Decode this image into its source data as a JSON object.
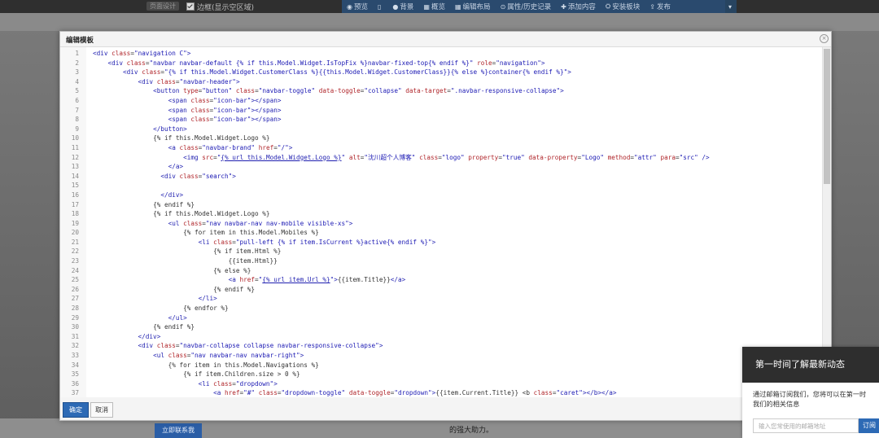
{
  "topbar": {
    "mode_label": "页面设计",
    "border_toggle_label": "边框(显示空区域)",
    "tools": [
      {
        "icon": "eye-icon",
        "glyph": "◉",
        "label": "预览"
      },
      {
        "icon": "mobile-icon",
        "glyph": "▯",
        "label": ""
      },
      {
        "icon": "droplet-icon",
        "glyph": "●",
        "label": "背景"
      },
      {
        "icon": "grid-icon",
        "glyph": "▦",
        "label": "概览"
      },
      {
        "icon": "layout-icon",
        "glyph": "▦",
        "label": "编辑布局"
      },
      {
        "icon": "history-icon",
        "glyph": "⊙",
        "label": "属性/历史记录"
      },
      {
        "icon": "plus-icon",
        "glyph": "✚",
        "label": "添加内容"
      },
      {
        "icon": "install-icon",
        "glyph": "⛭",
        "label": "安装板块"
      },
      {
        "icon": "publish-icon",
        "glyph": "⇪",
        "label": "发布"
      }
    ]
  },
  "dialog": {
    "title": "编辑模板",
    "ok_label": "确定",
    "cancel_label": "取消"
  },
  "code_lines": [
    {
      "n": "1",
      "indent": 0,
      "tokens": [
        [
          "tag",
          "<div "
        ],
        [
          "attr",
          "class"
        ],
        [
          "text",
          "="
        ],
        [
          "str",
          "\"navigation C\""
        ],
        [
          "tag",
          ">"
        ]
      ]
    },
    {
      "n": "2",
      "indent": 2,
      "tokens": [
        [
          "tag",
          "<div "
        ],
        [
          "attr",
          "class"
        ],
        [
          "text",
          "="
        ],
        [
          "str",
          "\"navbar navbar-default {% if this.Model.Widget.IsTopFix %}navbar-fixed-top{% endif %}\""
        ],
        [
          "text",
          " "
        ],
        [
          "attr",
          "role"
        ],
        [
          "text",
          "="
        ],
        [
          "str",
          "\"navigation\""
        ],
        [
          "tag",
          ">"
        ]
      ]
    },
    {
      "n": "3",
      "indent": 4,
      "tokens": [
        [
          "tag",
          "<div "
        ],
        [
          "attr",
          "class"
        ],
        [
          "text",
          "="
        ],
        [
          "str",
          "\"{% if this.Model.Widget.CustomerClass %}{{this.Model.Widget.CustomerClass}}{% else %}container{% endif %}\""
        ],
        [
          "tag",
          ">"
        ]
      ]
    },
    {
      "n": "4",
      "indent": 6,
      "tokens": [
        [
          "tag",
          "<div "
        ],
        [
          "attr",
          "class"
        ],
        [
          "text",
          "="
        ],
        [
          "str",
          "\"navbar-header\""
        ],
        [
          "tag",
          ">"
        ]
      ]
    },
    {
      "n": "5",
      "indent": 8,
      "tokens": [
        [
          "tag",
          "<button "
        ],
        [
          "attr",
          "type"
        ],
        [
          "text",
          "="
        ],
        [
          "str",
          "\"button\""
        ],
        [
          "text",
          " "
        ],
        [
          "attr",
          "class"
        ],
        [
          "text",
          "="
        ],
        [
          "str",
          "\"navbar-toggle\""
        ],
        [
          "text",
          " "
        ],
        [
          "attr",
          "data-toggle"
        ],
        [
          "text",
          "="
        ],
        [
          "str",
          "\"collapse\""
        ],
        [
          "text",
          " "
        ],
        [
          "attr",
          "data-target"
        ],
        [
          "text",
          "="
        ],
        [
          "str",
          "\".navbar-responsive-collapse\""
        ],
        [
          "tag",
          ">"
        ]
      ]
    },
    {
      "n": "6",
      "indent": 10,
      "tokens": [
        [
          "tag",
          "<span "
        ],
        [
          "attr",
          "class"
        ],
        [
          "text",
          "="
        ],
        [
          "str",
          "\"icon-bar\""
        ],
        [
          "tag",
          "></span>"
        ]
      ]
    },
    {
      "n": "7",
      "indent": 10,
      "tokens": [
        [
          "tag",
          "<span "
        ],
        [
          "attr",
          "class"
        ],
        [
          "text",
          "="
        ],
        [
          "str",
          "\"icon-bar\""
        ],
        [
          "tag",
          "></span>"
        ]
      ]
    },
    {
      "n": "8",
      "indent": 10,
      "tokens": [
        [
          "tag",
          "<span "
        ],
        [
          "attr",
          "class"
        ],
        [
          "text",
          "="
        ],
        [
          "str",
          "\"icon-bar\""
        ],
        [
          "tag",
          "></span>"
        ]
      ]
    },
    {
      "n": "9",
      "indent": 8,
      "tokens": [
        [
          "tag",
          "</button>"
        ]
      ]
    },
    {
      "n": "10",
      "indent": 8,
      "tokens": [
        [
          "text",
          "{% if this.Model.Widget.Logo %}"
        ]
      ]
    },
    {
      "n": "11",
      "indent": 10,
      "tokens": [
        [
          "tag",
          "<a "
        ],
        [
          "attr",
          "class"
        ],
        [
          "text",
          "="
        ],
        [
          "str",
          "\"navbar-brand\""
        ],
        [
          "text",
          " "
        ],
        [
          "attr",
          "href"
        ],
        [
          "text",
          "="
        ],
        [
          "str",
          "\"/\""
        ],
        [
          "tag",
          ">"
        ]
      ]
    },
    {
      "n": "12",
      "indent": 12,
      "tokens": [
        [
          "tag",
          "<img "
        ],
        [
          "attr",
          "src"
        ],
        [
          "text",
          "="
        ],
        [
          "str",
          "\""
        ],
        [
          "url",
          "{% url this.Model.Widget.Logo %}"
        ],
        [
          "str",
          "\""
        ],
        [
          "text",
          " "
        ],
        [
          "attr",
          "alt"
        ],
        [
          "text",
          "="
        ],
        [
          "str",
          "\"沈川超个人博客\""
        ],
        [
          "text",
          " "
        ],
        [
          "attr",
          "class"
        ],
        [
          "text",
          "="
        ],
        [
          "str",
          "\"logo\""
        ],
        [
          "text",
          " "
        ],
        [
          "attr",
          "property"
        ],
        [
          "text",
          "="
        ],
        [
          "str",
          "\"true\""
        ],
        [
          "text",
          " "
        ],
        [
          "attr",
          "data-property"
        ],
        [
          "text",
          "="
        ],
        [
          "str",
          "\"Logo\""
        ],
        [
          "text",
          " "
        ],
        [
          "attr",
          "method"
        ],
        [
          "text",
          "="
        ],
        [
          "str",
          "\"attr\""
        ],
        [
          "text",
          " "
        ],
        [
          "attr",
          "para"
        ],
        [
          "text",
          "="
        ],
        [
          "str",
          "\"src\""
        ],
        [
          "text",
          " "
        ],
        [
          "tag",
          "/>"
        ]
      ]
    },
    {
      "n": "13",
      "indent": 10,
      "tokens": [
        [
          "tag",
          "</a>"
        ]
      ]
    },
    {
      "n": "14",
      "indent": 9,
      "tokens": [
        [
          "tag",
          "<div "
        ],
        [
          "attr",
          "class"
        ],
        [
          "text",
          "="
        ],
        [
          "str",
          "\"search\""
        ],
        [
          "tag",
          ">"
        ]
      ]
    },
    {
      "n": "15",
      "indent": 0,
      "tokens": []
    },
    {
      "n": "16",
      "indent": 9,
      "tokens": [
        [
          "tag",
          "</div>"
        ]
      ]
    },
    {
      "n": "17",
      "indent": 8,
      "tokens": [
        [
          "text",
          "{% endif %}"
        ]
      ]
    },
    {
      "n": "18",
      "indent": 8,
      "tokens": [
        [
          "text",
          "{% if this.Model.Widget.Logo %}"
        ]
      ]
    },
    {
      "n": "19",
      "indent": 10,
      "tokens": [
        [
          "tag",
          "<ul "
        ],
        [
          "attr",
          "class"
        ],
        [
          "text",
          "="
        ],
        [
          "str",
          "\"nav navbar-nav nav-mobile visible-xs\""
        ],
        [
          "tag",
          ">"
        ]
      ]
    },
    {
      "n": "20",
      "indent": 12,
      "tokens": [
        [
          "text",
          "{% for item in this.Model.Mobiles %}"
        ]
      ]
    },
    {
      "n": "21",
      "indent": 14,
      "tokens": [
        [
          "tag",
          "<li "
        ],
        [
          "attr",
          "class"
        ],
        [
          "text",
          "="
        ],
        [
          "str",
          "\"pull-left {% if item.IsCurrent %}active{% endif %}\""
        ],
        [
          "tag",
          ">"
        ]
      ]
    },
    {
      "n": "22",
      "indent": 16,
      "tokens": [
        [
          "text",
          "{% if item.Html %}"
        ]
      ]
    },
    {
      "n": "23",
      "indent": 18,
      "tokens": [
        [
          "text",
          "{{item.Html}}"
        ]
      ]
    },
    {
      "n": "24",
      "indent": 16,
      "tokens": [
        [
          "text",
          "{% else %}"
        ]
      ]
    },
    {
      "n": "25",
      "indent": 18,
      "tokens": [
        [
          "tag",
          "<a "
        ],
        [
          "attr",
          "href"
        ],
        [
          "text",
          "="
        ],
        [
          "str",
          "\""
        ],
        [
          "url",
          "{% url item.Url %}"
        ],
        [
          "str",
          "\""
        ],
        [
          "tag",
          ">"
        ],
        [
          "text",
          "{{item.Title}}"
        ],
        [
          "tag",
          "</a>"
        ]
      ]
    },
    {
      "n": "26",
      "indent": 16,
      "tokens": [
        [
          "text",
          "{% endif %}"
        ]
      ]
    },
    {
      "n": "27",
      "indent": 14,
      "tokens": [
        [
          "tag",
          "</li>"
        ]
      ]
    },
    {
      "n": "28",
      "indent": 12,
      "tokens": [
        [
          "text",
          "{% endfor %}"
        ]
      ]
    },
    {
      "n": "29",
      "indent": 10,
      "tokens": [
        [
          "tag",
          "</ul>"
        ]
      ]
    },
    {
      "n": "30",
      "indent": 8,
      "tokens": [
        [
          "text",
          "{% endif %}"
        ]
      ]
    },
    {
      "n": "31",
      "indent": 6,
      "tokens": [
        [
          "tag",
          "</div>"
        ]
      ]
    },
    {
      "n": "32",
      "indent": 6,
      "tokens": [
        [
          "tag",
          "<div "
        ],
        [
          "attr",
          "class"
        ],
        [
          "text",
          "="
        ],
        [
          "str",
          "\"navbar-collapse collapse navbar-responsive-collapse\""
        ],
        [
          "tag",
          ">"
        ]
      ]
    },
    {
      "n": "33",
      "indent": 8,
      "tokens": [
        [
          "tag",
          "<ul "
        ],
        [
          "attr",
          "class"
        ],
        [
          "text",
          "="
        ],
        [
          "str",
          "\"nav navbar-nav navbar-right\""
        ],
        [
          "tag",
          ">"
        ]
      ]
    },
    {
      "n": "34",
      "indent": 10,
      "tokens": [
        [
          "text",
          "{% for item in this.Model.Navigations %}"
        ]
      ]
    },
    {
      "n": "35",
      "indent": 12,
      "tokens": [
        [
          "text",
          "{% if item.Children.size > 0 %}"
        ]
      ]
    },
    {
      "n": "36",
      "indent": 14,
      "tokens": [
        [
          "tag",
          "<li "
        ],
        [
          "attr",
          "class"
        ],
        [
          "text",
          "="
        ],
        [
          "str",
          "\"dropdown\""
        ],
        [
          "tag",
          ">"
        ]
      ]
    },
    {
      "n": "37",
      "indent": 16,
      "tokens": [
        [
          "tag",
          "<a "
        ],
        [
          "attr",
          "href"
        ],
        [
          "text",
          "="
        ],
        [
          "str",
          "\"#\""
        ],
        [
          "text",
          " "
        ],
        [
          "attr",
          "class"
        ],
        [
          "text",
          "="
        ],
        [
          "str",
          "\"dropdown-toggle\""
        ],
        [
          "text",
          " "
        ],
        [
          "attr",
          "data-toggle"
        ],
        [
          "text",
          "="
        ],
        [
          "str",
          "\"dropdown\""
        ],
        [
          "tag",
          ">"
        ],
        [
          "text",
          "{{item.Current.Title}} <b "
        ],
        [
          "attr",
          "class"
        ],
        [
          "text",
          "="
        ],
        [
          "str",
          "\"caret\""
        ],
        [
          "tag",
          "></b></a>"
        ]
      ]
    }
  ],
  "background_page": {
    "contact_button": "立即联系我",
    "bottom_text": "的强大助力。"
  },
  "subscribe": {
    "heading": "第一时间了解最新动态",
    "desc_line1": "通过邮箱订阅我们，您将可以在第一时",
    "desc_line2": "我们的相关信息",
    "email_placeholder": "输入您常使用的邮箱地址",
    "submit_label": "订阅"
  }
}
